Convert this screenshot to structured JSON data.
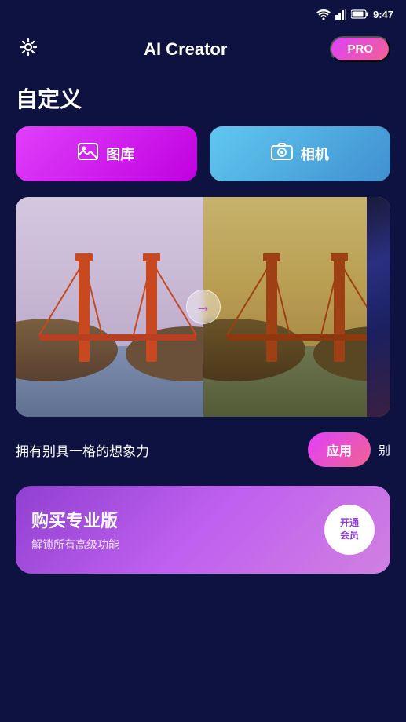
{
  "statusBar": {
    "time": "9:47",
    "icons": [
      "wifi",
      "signal",
      "battery"
    ]
  },
  "header": {
    "title": "AI Creator",
    "proBadge": "PRO",
    "settingsIcon": "gear-icon"
  },
  "sectionTitle": "自定义",
  "actionButtons": {
    "gallery": {
      "label": "图库",
      "icon": "image-icon"
    },
    "camera": {
      "label": "相机",
      "icon": "camera-icon"
    }
  },
  "previewArrow": "→",
  "bottomRow": {
    "text": "拥有别具一格的想象力",
    "applyButton": "应用",
    "moreText": "别"
  },
  "proCard": {
    "title": "购买专业版",
    "subtitle": "解锁所有高级功能",
    "activateButton": "开通\n会员"
  }
}
